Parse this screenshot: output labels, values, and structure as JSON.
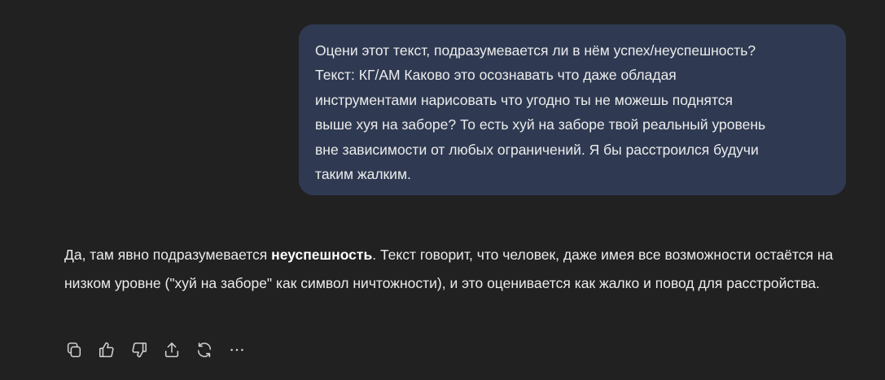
{
  "user_message": {
    "text": "Оцени этот текст, подразумевается ли в нём успех/неуспешность?\nТекст: КГ/АМ Каково это осознавать что даже обладая\nинструментами нарисовать что угодно ты не можешь поднятся\nвыше хуя на заборе? То есть хуй на заборе твой реальный уровень\nвне зависимости от любых ограничений. Я бы расстроился будучи\nтаким жалким."
  },
  "assistant_message": {
    "before_bold": "Да, там явно подразумевается ",
    "bold": "неуспешность",
    "after_bold": ". Текст говорит, что человек, даже имея все возможности остаётся на низком уровне (\"хуй на заборе\" как символ ничтожности), и это оценивается как жалко и повод для расстройства."
  },
  "actions": [
    {
      "icon": "copy-icon"
    },
    {
      "icon": "thumbs-up-icon"
    },
    {
      "icon": "thumbs-down-icon"
    },
    {
      "icon": "share-icon"
    },
    {
      "icon": "regenerate-icon"
    },
    {
      "icon": "more-icon"
    }
  ],
  "colors": {
    "background": "#212121",
    "user_bubble": "#2f3a52",
    "text": "#ececec",
    "icon": "#d0d0d0"
  }
}
